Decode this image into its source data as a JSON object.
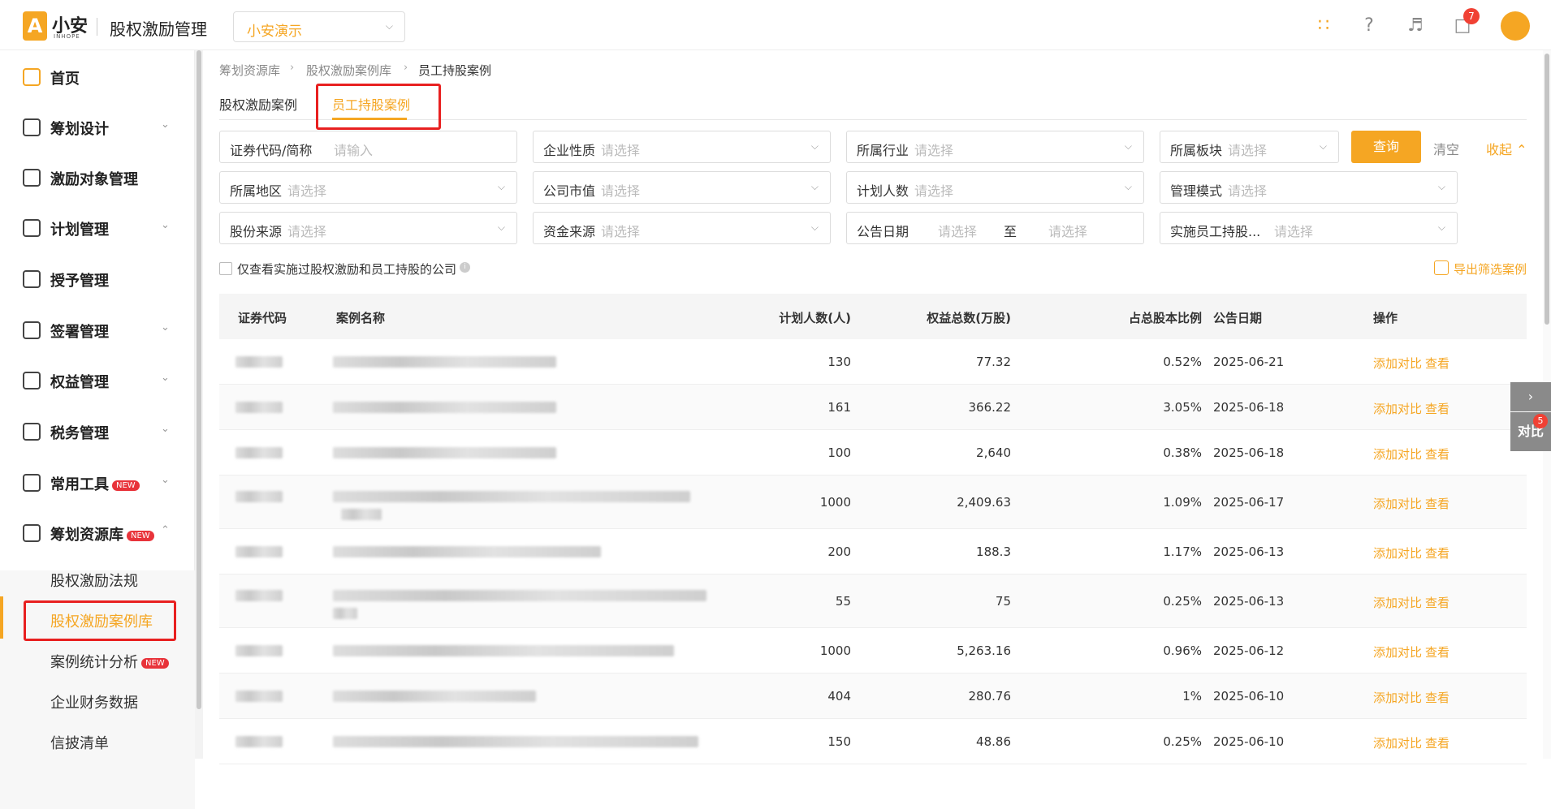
{
  "header": {
    "logo_text": "小安",
    "logo_sub": "INHOPE",
    "app_title": "股权激励管理",
    "org_select": "小安演示",
    "message_count": "7"
  },
  "sidebar": {
    "items": [
      {
        "label": "首页"
      },
      {
        "label": "筹划设计"
      },
      {
        "label": "激励对象管理"
      },
      {
        "label": "计划管理"
      },
      {
        "label": "授予管理"
      },
      {
        "label": "签署管理"
      },
      {
        "label": "权益管理"
      },
      {
        "label": "税务管理"
      },
      {
        "label": "常用工具",
        "badge": "NEW"
      },
      {
        "label": "筹划资源库",
        "badge": "NEW"
      }
    ],
    "sub_items": [
      {
        "label": "股权激励法规"
      },
      {
        "label": "股权激励案例库"
      },
      {
        "label": "案例统计分析",
        "badge": "NEW"
      },
      {
        "label": "企业财务数据"
      },
      {
        "label": "信披清单"
      }
    ]
  },
  "breadcrumb": [
    "筹划资源库",
    "股权激励案例库",
    "员工持股案例"
  ],
  "tabs": [
    "股权激励案例",
    "员工持股案例"
  ],
  "filters": {
    "code": {
      "label": "证券代码/简称",
      "placeholder": "请输入"
    },
    "nature": {
      "label": "企业性质",
      "placeholder": "请选择"
    },
    "industry": {
      "label": "所属行业",
      "placeholder": "请选择"
    },
    "board": {
      "label": "所属板块",
      "placeholder": "请选择"
    },
    "region": {
      "label": "所属地区",
      "placeholder": "请选择"
    },
    "market_value": {
      "label": "公司市值",
      "placeholder": "请选择"
    },
    "plan_people": {
      "label": "计划人数",
      "placeholder": "请选择"
    },
    "mgmt_mode": {
      "label": "管理模式",
      "placeholder": "请选择"
    },
    "share_source": {
      "label": "股份来源",
      "placeholder": "请选择"
    },
    "fund_source": {
      "label": "资金来源",
      "placeholder": "请选择"
    },
    "announce_date": {
      "label": "公告日期",
      "start": "请选择",
      "sep": "至",
      "end": "请选择"
    },
    "impl": {
      "label": "实施员工持股...",
      "placeholder": "请选择"
    }
  },
  "buttons": {
    "query": "查询",
    "clear": "清空",
    "collapse": "收起",
    "export": "导出筛选案例"
  },
  "checkbox_label": "仅查看实施过股权激励和员工持股的公司",
  "table": {
    "headers": [
      "证券代码",
      "案例名称",
      "计划人数(人)",
      "权益总数(万股)",
      "占总股本比例",
      "公告日期",
      "操作"
    ],
    "rows": [
      {
        "people": "130",
        "total": "77.32",
        "ratio": "0.52%",
        "date": "2025-06-21"
      },
      {
        "people": "161",
        "total": "366.22",
        "ratio": "3.05%",
        "date": "2025-06-18"
      },
      {
        "people": "100",
        "total": "2,640",
        "ratio": "0.38%",
        "date": "2025-06-18"
      },
      {
        "people": "1000",
        "total": "2,409.63",
        "ratio": "1.09%",
        "date": "2025-06-17"
      },
      {
        "people": "200",
        "total": "188.3",
        "ratio": "1.17%",
        "date": "2025-06-13"
      },
      {
        "people": "55",
        "total": "75",
        "ratio": "0.25%",
        "date": "2025-06-13"
      },
      {
        "people": "1000",
        "total": "5,263.16",
        "ratio": "0.96%",
        "date": "2025-06-12"
      },
      {
        "people": "404",
        "total": "280.76",
        "ratio": "1%",
        "date": "2025-06-10"
      },
      {
        "people": "150",
        "total": "48.86",
        "ratio": "0.25%",
        "date": "2025-06-10"
      }
    ],
    "op_compare": "添加对比",
    "op_view": "查看"
  },
  "compare_panel": {
    "label": "对比",
    "count": "5"
  }
}
